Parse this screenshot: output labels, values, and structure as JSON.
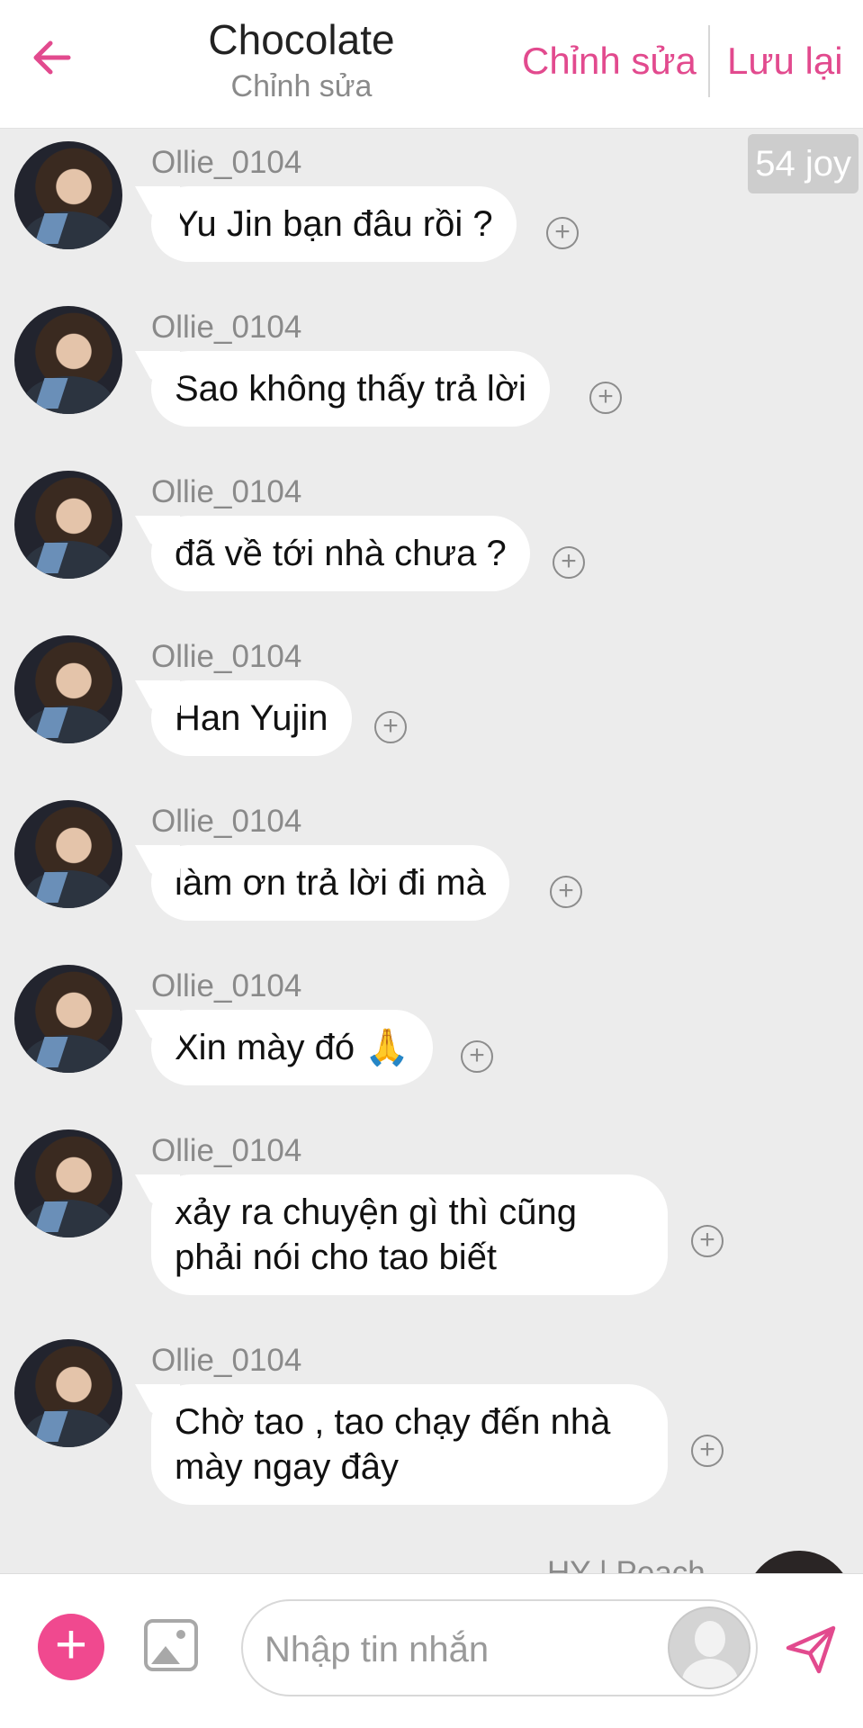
{
  "header": {
    "title": "Chocolate",
    "subtitle": "Chỉnh sửa",
    "edit_label": "Chỉnh sửa",
    "save_label": "Lưu lại",
    "back_icon": "arrow-left-icon",
    "accent_color": "#e24a8e"
  },
  "badge": {
    "joy": "54 joy"
  },
  "messages": [
    {
      "username": "Ollie_0104",
      "text": "Yu Jin bạn đâu rồi ?"
    },
    {
      "username": "Ollie_0104",
      "text": "Sao không thấy trả lời"
    },
    {
      "username": "Ollie_0104",
      "text": "đã về tới nhà chưa ?"
    },
    {
      "username": "Ollie_0104",
      "text": "Han Yujin"
    },
    {
      "username": "Ollie_0104",
      "text": "làm ơn trả lời đi mà"
    },
    {
      "username": "Ollie_0104",
      "text": "Xin mày đó 🙏"
    },
    {
      "username": "Ollie_0104",
      "text": "xảy ra chuyện gì thì cũng phải nói cho tao biết"
    },
    {
      "username": "Ollie_0104",
      "text": "Chờ tao , tao chạy đến nhà mày ngay đây"
    }
  ],
  "partial_message": {
    "username": "HY | Peach"
  },
  "composer": {
    "placeholder": "Nhập tin nhắn",
    "add_icon": "plus-icon",
    "image_icon": "image-icon",
    "send_icon": "send-icon",
    "plus_color": "#f0498f"
  }
}
